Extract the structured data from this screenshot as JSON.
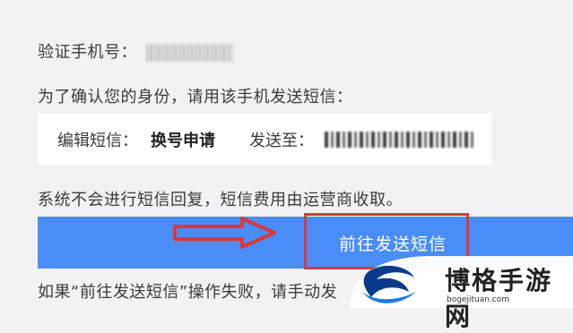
{
  "verify": {
    "label": "验证手机号："
  },
  "instruction": "为了确认您的身份，请用该手机发送短信：",
  "sms": {
    "edit_label": "编辑短信：",
    "edit_value": "换号申请",
    "send_to_label": "发送至："
  },
  "notice": "系统不会进行短信回复，短信费用由运营商收取。",
  "send_button": {
    "label": "前往发送短信"
  },
  "fail_note": "如果“前往发送短信”操作失败，请手动发",
  "watermark": {
    "name": "博格手游网",
    "url": "bogejituan.com"
  },
  "colors": {
    "button": "#4a8df8",
    "highlight": "#d9393b",
    "background": "#f2f2f4"
  },
  "icons": {
    "arrow": "right-arrow-icon",
    "logo": "bird-logo-icon"
  }
}
